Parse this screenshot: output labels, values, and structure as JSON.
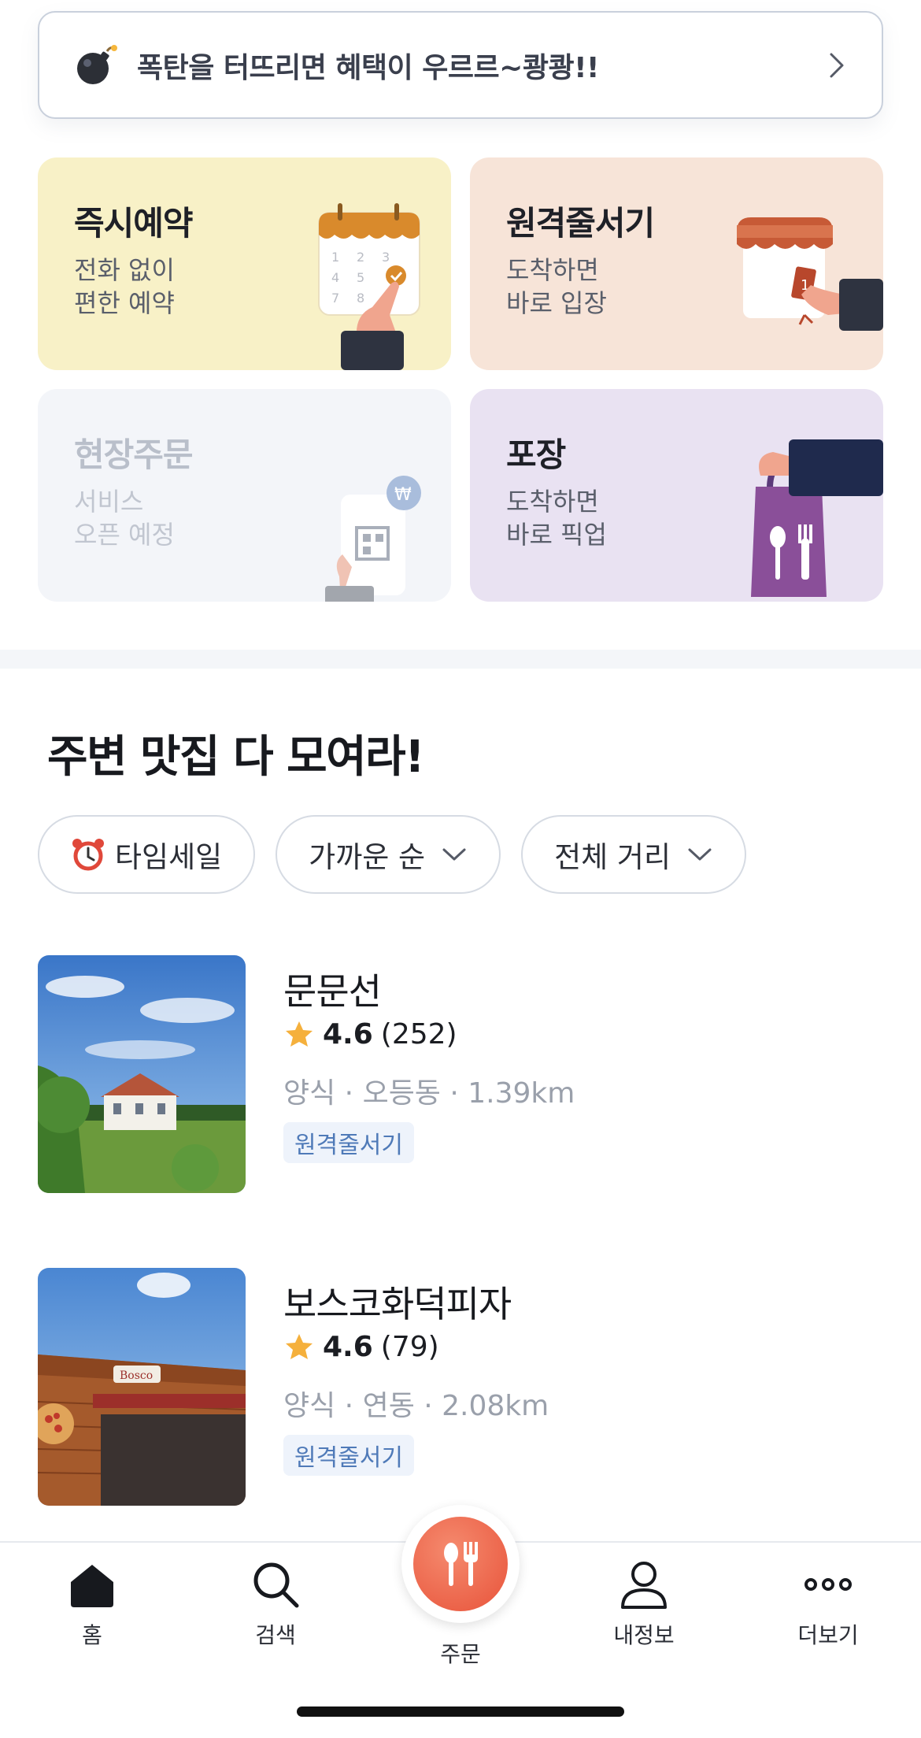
{
  "banner": {
    "text": "폭탄을 터뜨리면 혜택이 우르르~쾅쾅!!",
    "icon": "bomb-icon"
  },
  "services": [
    {
      "title": "즉시예약",
      "desc": "전화 없이\n편한 예약",
      "bg": "#f8f1c7",
      "state": "active"
    },
    {
      "title": "원격줄서기",
      "desc": "도착하면\n바로 입장",
      "bg": "#f7e4d8",
      "state": "active"
    },
    {
      "title": "현장주문",
      "desc": "서비스\n오픈 예정",
      "bg": "#f3f5f9",
      "state": "disabled"
    },
    {
      "title": "포장",
      "desc": "도착하면\n바로 픽업",
      "bg": "#e9e2f2",
      "state": "active"
    }
  ],
  "nearby": {
    "title": "주변 맛집 다 모여라!",
    "filters": [
      {
        "label": "타임세일",
        "icon": "alarm-clock-icon"
      },
      {
        "label": "가까운 순",
        "icon": "chevron-down-icon"
      },
      {
        "label": "전체 거리",
        "icon": "chevron-down-icon"
      }
    ],
    "stores": [
      {
        "name": "문문선",
        "score": "4.6",
        "count": "(252)",
        "meta": "양식 · 오등동 · 1.39km",
        "tag": "원격줄서기"
      },
      {
        "name": "보스코화덕피자",
        "score": "4.6",
        "count": "(79)",
        "meta": "양식 · 연동 · 2.08km",
        "tag": "원격줄서기"
      }
    ]
  },
  "tabbar": {
    "tabs": [
      {
        "label": "홈",
        "icon": "home-icon",
        "active": true
      },
      {
        "label": "검색",
        "icon": "search-icon"
      },
      {
        "label": "주문",
        "icon": "spoon-fork-icon"
      },
      {
        "label": "내정보",
        "icon": "person-icon"
      },
      {
        "label": "더보기",
        "icon": "more-dots-icon"
      }
    ]
  },
  "colors": {
    "accent": "#e8533a",
    "tag_bg": "#eef3fb",
    "tag_text": "#4f7ab8"
  }
}
